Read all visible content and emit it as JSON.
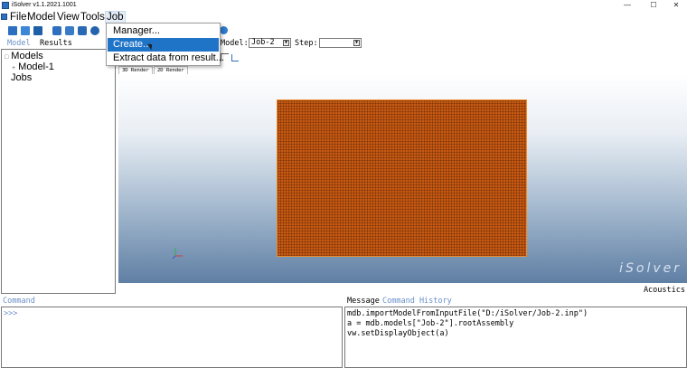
{
  "window": {
    "title": "iSolver v1.1.2021.1001",
    "minimize": "—",
    "maximize": "☐",
    "close": "✕"
  },
  "menubar": {
    "items": [
      "File",
      "Model",
      "View",
      "Tools",
      "Job"
    ],
    "active": "Job"
  },
  "job_menu": {
    "items": [
      "Manager...",
      "Create...",
      "Extract data from result..."
    ],
    "highlighted": "Create..."
  },
  "left_panel": {
    "tabs": [
      "Model",
      "Results"
    ],
    "tree": {
      "root": "Models",
      "child": "Model-1",
      "jobs": "Jobs",
      "expander": "+"
    }
  },
  "selectors": {
    "model_label": "Model:",
    "model_value": "Job-2",
    "step_label": "Step:",
    "step_value": ""
  },
  "render_tabs": [
    "3D Render",
    "2D Render"
  ],
  "viewport": {
    "brand": "iSolver",
    "mesh_color": "#c85a12",
    "mesh_border": "#f08a28"
  },
  "module_label": "Acoustics",
  "command": {
    "label": "Command",
    "prompt": ">>>"
  },
  "message": {
    "tabs": [
      "Message",
      "Command History"
    ],
    "lines": [
      "mdb.importModelFromInputFile(\"D:/iSolver/Job-2.inp\")",
      "a = mdb.models[\"Job-2\"].rootAssembly",
      "vw.setDisplayObject(a)"
    ]
  },
  "colors": {
    "accent": "#1f74c8",
    "tab_label": "#6a8fc8"
  }
}
